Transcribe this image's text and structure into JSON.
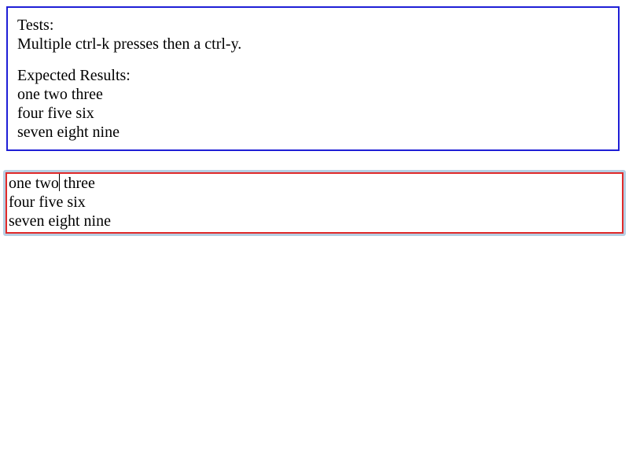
{
  "info": {
    "tests_heading": "Tests:",
    "tests_description": "Multiple ctrl-k presses then a ctrl-y.",
    "expected_heading": "Expected Results:",
    "expected_lines": [
      "one two three",
      "four five six",
      "seven eight nine"
    ]
  },
  "editor": {
    "line1_before_caret": "one two",
    "line1_after_caret": " three",
    "line2": "four five six",
    "line3": "seven eight nine"
  },
  "colors": {
    "info_border": "#1f1fd6",
    "editor_border": "#e02a2a",
    "focus_ring": "#b6cfe3"
  }
}
